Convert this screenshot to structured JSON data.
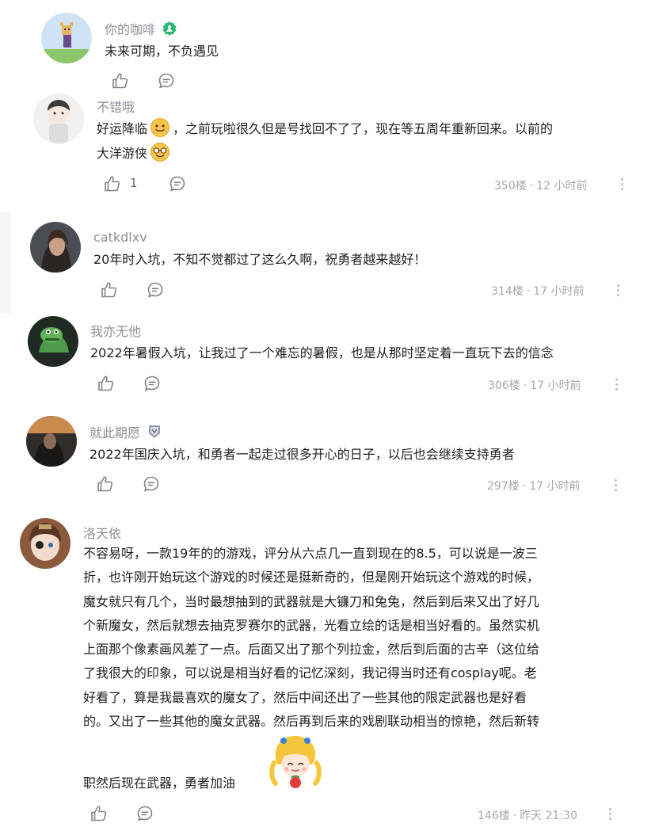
{
  "colors": {
    "name": "#8a8f96",
    "text": "#1b1f23",
    "meta": "#a3a8ae",
    "icon": "#7f848a",
    "badge": "#2bb673"
  },
  "comments": [
    {
      "username": "你的咖啡",
      "text": "未来可期，不负遇见",
      "badge_icon": "green-badge-icon"
    },
    {
      "username": "不错哦",
      "text_line1_a": "好运降临",
      "text_line1_b": "，之前玩啦很久但是号找回不了了，现在等五周年重新回来。以前的",
      "text_line2": "大洋游侠",
      "like_count": "1",
      "floor": "350楼",
      "time": "12 小时前"
    },
    {
      "username": "catkdlxv",
      "text": "20年时入坑，不知不觉都过了这么久啊，祝勇者越来越好！",
      "floor": "314楼",
      "time": "17 小时前"
    },
    {
      "username": "我亦无他",
      "text": "2022年暑假入坑，让我过了一个难忘的暑假，也是从那时坚定着一直玩下去的信念",
      "floor": "306楼",
      "time": "17 小时前"
    },
    {
      "username": "就此期愿",
      "text": "2022年国庆入坑，和勇者一起走过很多开心的日子，以后也会继续支持勇者",
      "floor": "297楼",
      "time": "17 小时前"
    },
    {
      "username": "洛天依",
      "lines": [
        "不容易呀，一款19年的的游戏，评分从六点几一直到现在的8.5，可以说是一波三",
        "折，也许刚开始玩这个游戏的时候还是挺新奇的，但是刚开始玩这个游戏的时候，",
        "魔女就只有几个，当时最想抽到的武器就是大镰刀和兔兔，然后到后来又出了好几",
        "个新魔女，然后就想去抽克罗赛尔的武器，光看立绘的话是相当好看的。虽然实机",
        "上面那个像素画风差了一点。后面又出了那个列拉金，然后到后面的古辛（这位给",
        "了我很大的印象，可以说是相当好看的记忆深刻，我记得当时还有cosplay呢。老",
        "好看了，算是我最喜欢的魔女了，然后中间还出了一些其他的限定武器也是好看",
        "的。又出了一些其他的魔女武器。然后再到后来的戏剧联动相当的惊艳，然后新转"
      ],
      "last_line": "职然后现在武器，勇者加油",
      "floor": "146楼",
      "time": "昨天 21:30"
    }
  ]
}
